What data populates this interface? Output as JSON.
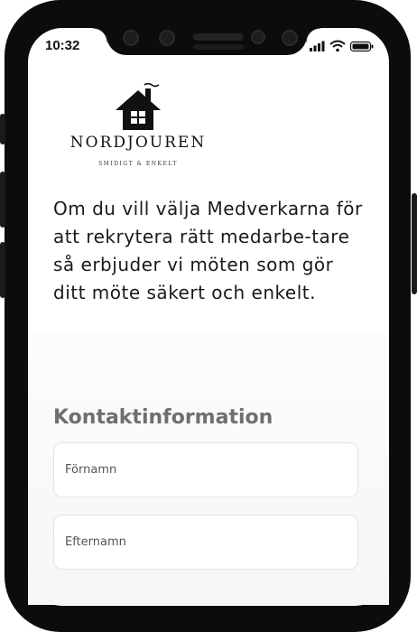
{
  "status_bar": {
    "time": "10:32",
    "icons": [
      "signal-icon",
      "wifi-icon",
      "battery-icon"
    ]
  },
  "logo": {
    "icon": "house-icon",
    "name": "NORDJOUREN",
    "tagline": "SMIDIGT & ENKELT"
  },
  "intro_text": "Om du vill välja Medverkarna för att rekrytera rätt medarbe-tare så erbjuder vi möten som gör ditt möte säkert och enkelt.",
  "form": {
    "title": "Kontaktinformation",
    "first_name_placeholder": "Förnamn",
    "last_name_placeholder": "Efternamn"
  },
  "colors": {
    "frame": "#0c0c0c",
    "title_gray": "#6f6f6f",
    "field_border": "#e3e3e3"
  }
}
